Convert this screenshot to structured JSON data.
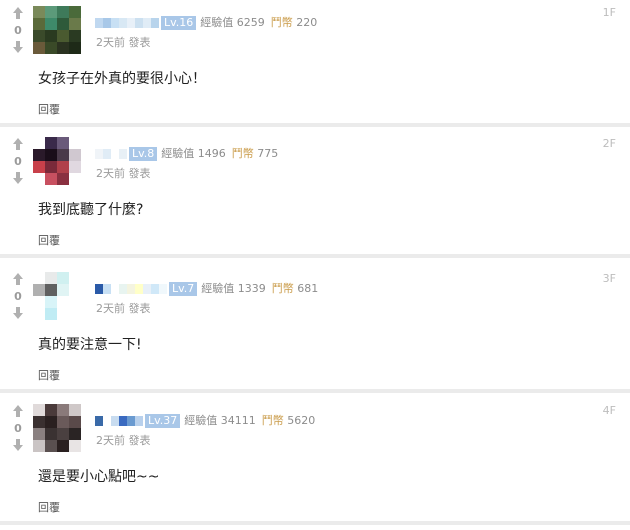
{
  "colors": {
    "level_bg": "#a9c7e8",
    "coin_label": "#c99a47",
    "separator": "#ebebeb"
  },
  "labels": {
    "exp": "經驗值",
    "coin": "鬥幣",
    "reply": "回覆",
    "posted": "發表"
  },
  "comments": [
    {
      "vote_count": "0",
      "level": "Lv.16",
      "exp": "6259",
      "coins": "220",
      "time": "2天前",
      "floor": "1F",
      "text": "女孩子在外真的要很小心！",
      "avatar_colors": [
        "#7a8a5a",
        "#5c9a7a",
        "#3e7a5a",
        "#4a6a3a",
        "#5a6a3a",
        "#3e8a6a",
        "#2e5a3a",
        "#6a7a4a",
        "#3a4a2a",
        "#2a3a20",
        "#4a5a30",
        "#2a3a22",
        "#6a5a3a",
        "#3a4a28",
        "#2a3220",
        "#1e2a18"
      ]
    },
    {
      "vote_count": "0",
      "level": "Lv.8",
      "exp": "1496",
      "coins": "775",
      "time": "2天前",
      "floor": "2F",
      "text": "我到底聽了什麼?",
      "avatar_colors": [
        "#ffffff",
        "#3a2a4a",
        "#6a5a7a",
        "#ffffff",
        "#2a1a2a",
        "#1a0e1a",
        "#4a3a4a",
        "#d0c8d0",
        "#c8404a",
        "#7a2a3a",
        "#b0404a",
        "#e0d8e0",
        "#ffffff",
        "#c85060",
        "#8a3040",
        "#ffffff"
      ]
    },
    {
      "vote_count": "0",
      "level": "Lv.7",
      "exp": "1339",
      "coins": "681",
      "time": "2天前",
      "floor": "3F",
      "text": "真的要注意一下!",
      "avatar_colors": [
        "#ffffff",
        "#e8eaea",
        "#d0f0f0",
        "#ffffff",
        "#b0b0b0",
        "#606060",
        "#e0f4f4",
        "#ffffff",
        "#ffffff",
        "#d8f4f8",
        "#ffffff",
        "#ffffff",
        "#ffffff",
        "#c0ecf4",
        "#ffffff",
        "#ffffff"
      ]
    },
    {
      "vote_count": "0",
      "level": "Lv.37",
      "exp": "34111",
      "coins": "5620",
      "time": "2天前",
      "floor": "4F",
      "text": "還是要小心點吧~~",
      "avatar_colors": [
        "#e0dada",
        "#4a3a3a",
        "#8a7a7a",
        "#cfc8c8",
        "#3a3030",
        "#2a2020",
        "#6a5a5a",
        "#5a4a4a",
        "#8a8080",
        "#3a3232",
        "#4a4040",
        "#2a2424",
        "#cac4c4",
        "#5a5050",
        "#2a2020",
        "#e8e4e4"
      ]
    }
  ]
}
